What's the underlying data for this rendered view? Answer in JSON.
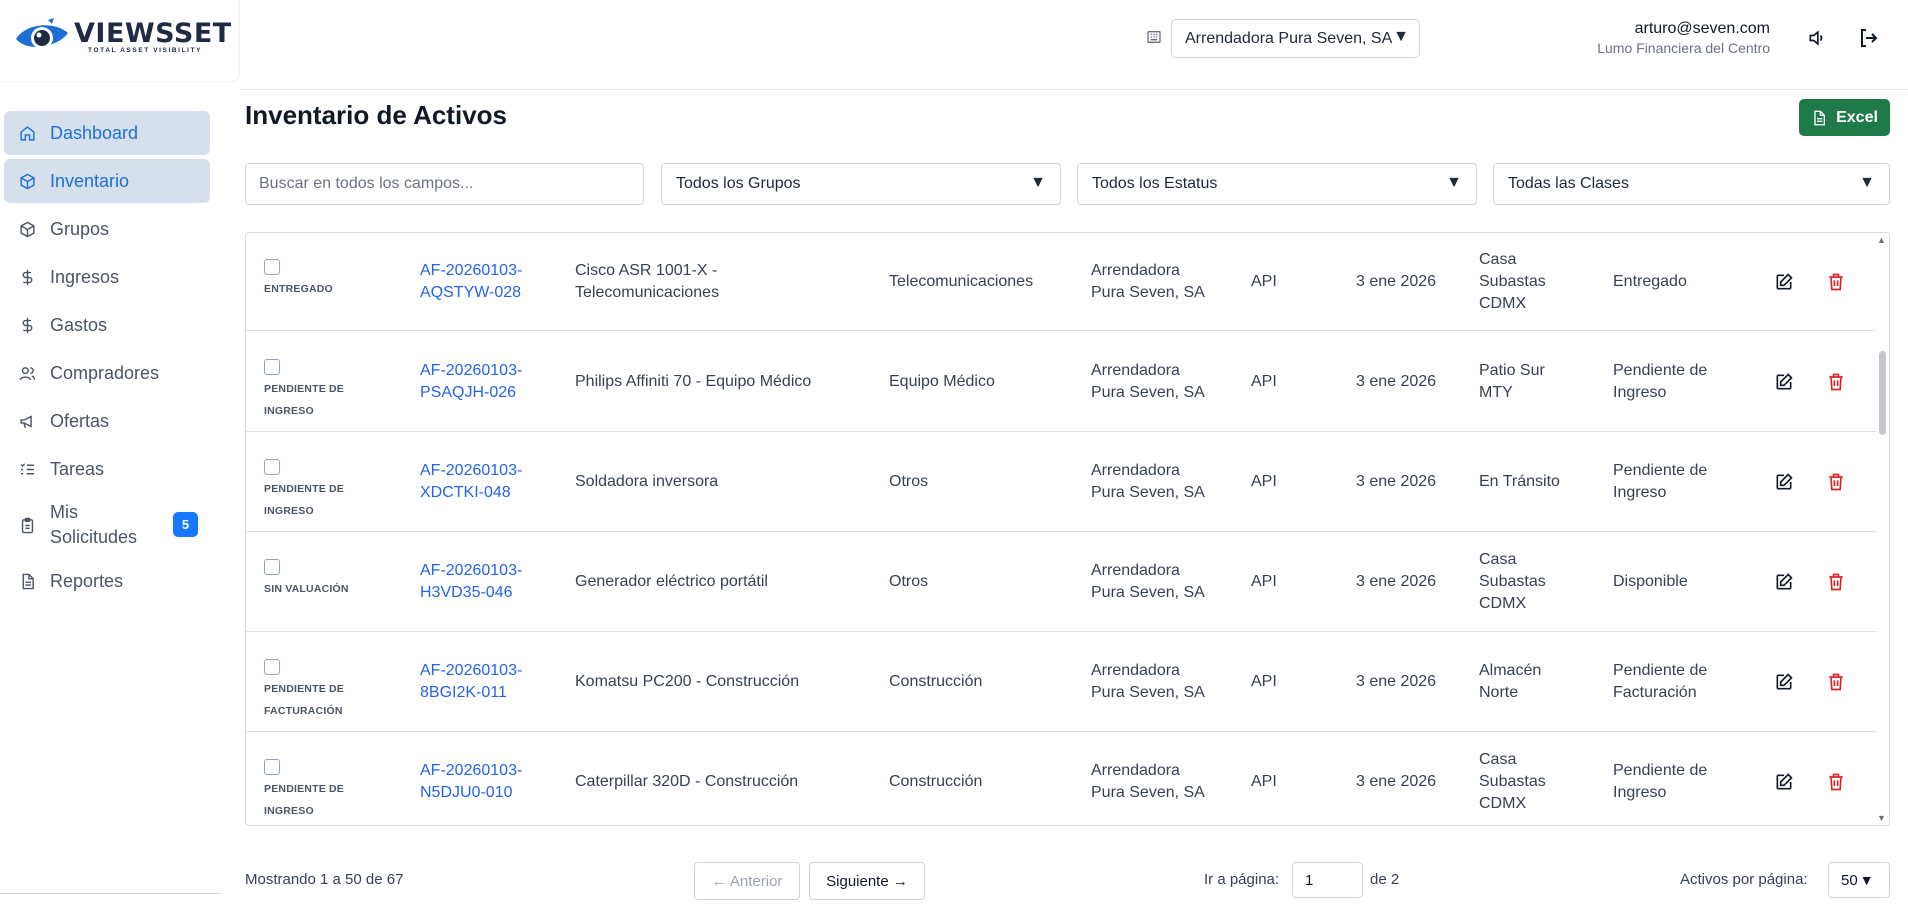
{
  "brand": {
    "name": "VIEWSSET",
    "tagline": "TOTAL ASSET VISIBILITY"
  },
  "sidebar": {
    "items": [
      {
        "label": "Dashboard",
        "icon": "home-icon"
      },
      {
        "label": "Inventario",
        "icon": "box-icon"
      },
      {
        "label": "Grupos",
        "icon": "box-icon"
      },
      {
        "label": "Ingresos",
        "icon": "dollar-icon"
      },
      {
        "label": "Gastos",
        "icon": "dollar-icon"
      },
      {
        "label": "Compradores",
        "icon": "users-icon"
      },
      {
        "label": "Ofertas",
        "icon": "megaphone-icon"
      },
      {
        "label": "Tareas",
        "icon": "list-check-icon"
      },
      {
        "label": "Mis Solicitudes",
        "icon": "clipboard-icon",
        "badge": "5"
      },
      {
        "label": "Reportes",
        "icon": "document-icon"
      }
    ],
    "active_items": [
      "Dashboard",
      "Inventario"
    ]
  },
  "header": {
    "company": "Arrendadora Pura Seven, SA",
    "user_email": "arturo@seven.com",
    "user_org": "Lumo Financiera del Centro"
  },
  "page": {
    "title": "Inventario de Activos",
    "excel_label": "Excel"
  },
  "filters": {
    "search_placeholder": "Buscar en todos los campos...",
    "groups": "Todos los Grupos",
    "status": "Todos los Estatus",
    "classes": "Todas las Clases"
  },
  "rows": [
    {
      "status": "ENTREGADO",
      "code": [
        "AF-20260103-",
        "AQSTYW-028"
      ],
      "name": [
        "Cisco ASR 1001-X -",
        "Telecomunicaciones"
      ],
      "group": "Telecomunicaciones",
      "company": [
        "Arrendadora",
        "Pura Seven, SA"
      ],
      "source": "API",
      "date": "3 ene 2026",
      "location": [
        "Casa",
        "Subastas",
        "CDMX"
      ],
      "state": [
        "Entregado"
      ]
    },
    {
      "status": "PENDIENTE DE INGRESO",
      "code": [
        "AF-20260103-",
        "PSAQJH-026"
      ],
      "name": [
        "Philips Affiniti 70 - Equipo Médico"
      ],
      "group": "Equipo Médico",
      "company": [
        "Arrendadora",
        "Pura Seven, SA"
      ],
      "source": "API",
      "date": "3 ene 2026",
      "location": [
        "Patio Sur",
        "MTY"
      ],
      "state": [
        "Pendiente de",
        "Ingreso"
      ]
    },
    {
      "status": "PENDIENTE DE INGRESO",
      "code": [
        "AF-20260103-",
        "XDCTKI-048"
      ],
      "name": [
        "Soldadora inversora"
      ],
      "group": "Otros",
      "company": [
        "Arrendadora",
        "Pura Seven, SA"
      ],
      "source": "API",
      "date": "3 ene 2026",
      "location": [
        "En Tránsito"
      ],
      "state": [
        "Pendiente de",
        "Ingreso"
      ]
    },
    {
      "status": "SIN VALUACIÓN",
      "code": [
        "AF-20260103-",
        "H3VD35-046"
      ],
      "name": [
        "Generador eléctrico portátil"
      ],
      "group": "Otros",
      "company": [
        "Arrendadora",
        "Pura Seven, SA"
      ],
      "source": "API",
      "date": "3 ene 2026",
      "location": [
        "Casa",
        "Subastas",
        "CDMX"
      ],
      "state": [
        "Disponible"
      ]
    },
    {
      "status": "PENDIENTE DE FACTURACIÓN",
      "code": [
        "AF-20260103-",
        "8BGI2K-011"
      ],
      "name": [
        "Komatsu PC200 - Construcción"
      ],
      "group": "Construcción",
      "company": [
        "Arrendadora",
        "Pura Seven, SA"
      ],
      "source": "API",
      "date": "3 ene 2026",
      "location": [
        "Almacén",
        "Norte"
      ],
      "state": [
        "Pendiente de",
        "Facturación"
      ]
    },
    {
      "status": "PENDIENTE DE INGRESO",
      "code": [
        "AF-20260103-",
        "N5DJU0-010"
      ],
      "name": [
        "Caterpillar 320D - Construcción"
      ],
      "group": "Construcción",
      "company": [
        "Arrendadora",
        "Pura Seven, SA"
      ],
      "source": "API",
      "date": "3 ene 2026",
      "location": [
        "Casa",
        "Subastas",
        "CDMX"
      ],
      "state": [
        "Pendiente de",
        "Ingreso"
      ]
    }
  ],
  "pagination": {
    "showing": "Mostrando 1 a 50 de 67",
    "prev": "← Anterior",
    "next": "Siguiente →",
    "goto_label": "Ir a página:",
    "goto_value": "1",
    "goto_total": "de 2",
    "perpage_label": "Activos por página:",
    "perpage_value": "50"
  },
  "colors": {
    "primary": "#1d6fd6",
    "active_bg": "#d6e0ec",
    "excel": "#1e7a48",
    "link": "#2563eb",
    "danger": "#dc2626"
  }
}
